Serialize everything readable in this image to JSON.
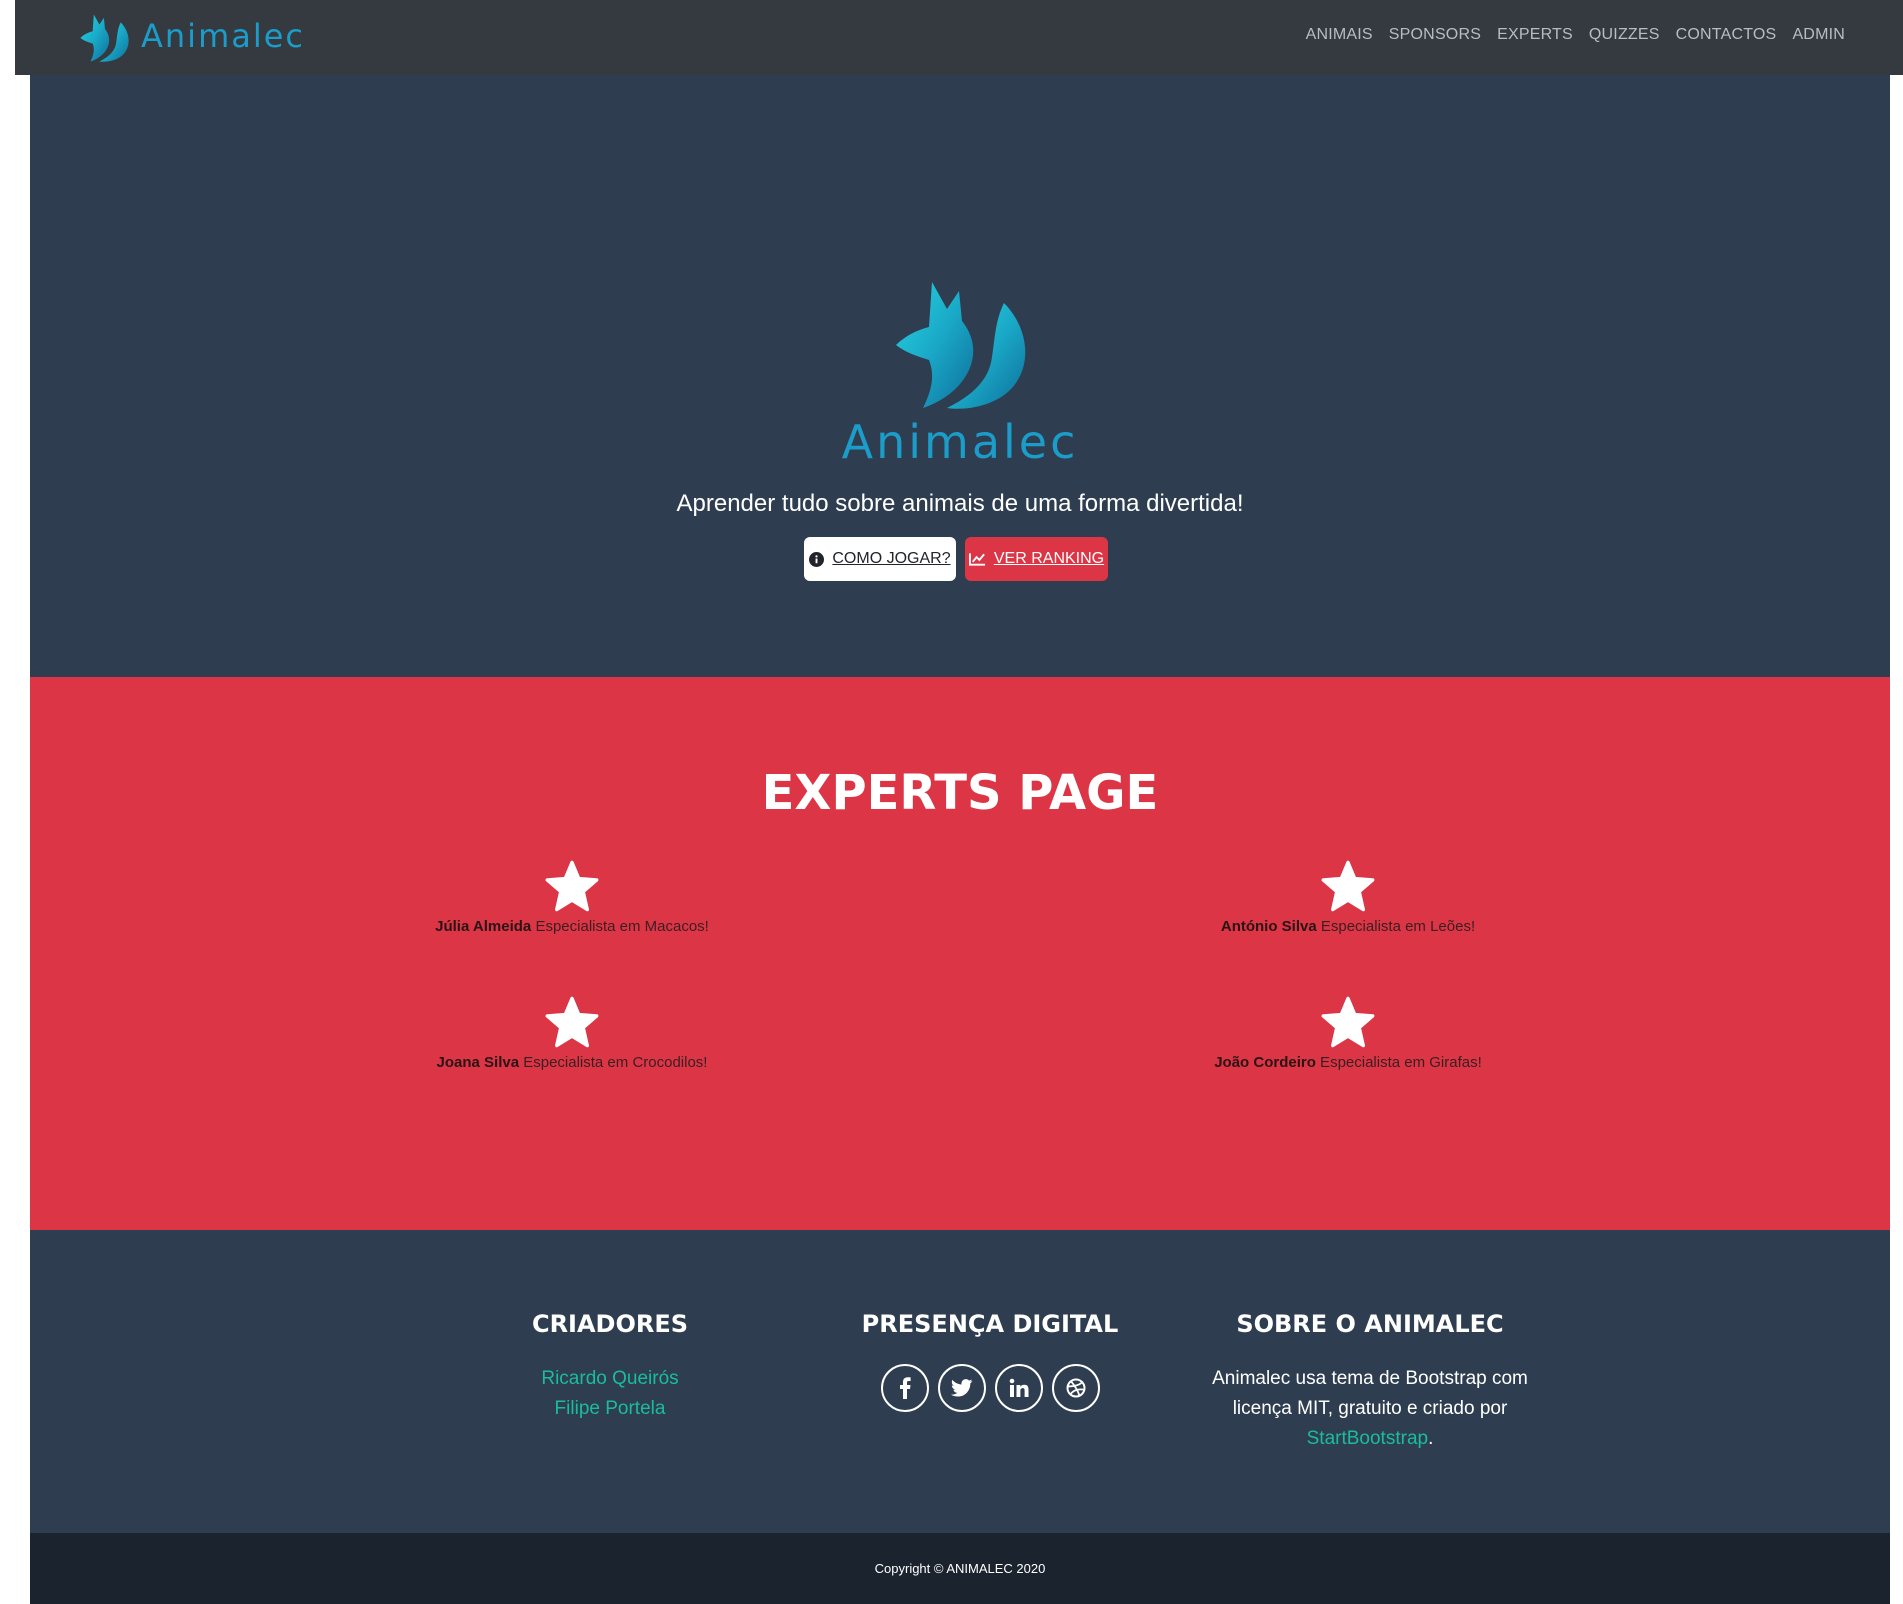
{
  "navbar": {
    "brand": "Animalec",
    "links": [
      "ANIMAIS",
      "SPONSORS",
      "EXPERTS",
      "QUIZZES",
      "CONTACTOS",
      "ADMIN"
    ]
  },
  "masthead": {
    "title": "Animalec",
    "subtitle": "Aprender tudo sobre animais de uma forma divertida!",
    "how_to_play": "COMO JOGAR?",
    "ranking": "VER RANKING"
  },
  "experts": {
    "title": "EXPERTS PAGE",
    "items": [
      {
        "name": "Júlia Almeida",
        "text": " Especialista em Macacos!"
      },
      {
        "name": "António Silva",
        "text": " Especialista em Leões!"
      },
      {
        "name": "Joana Silva",
        "text": " Especialista em Crocodilos!"
      },
      {
        "name": "João Cordeiro",
        "text": " Especialista em Girafas!"
      }
    ]
  },
  "footer": {
    "creators_heading": "CRIADORES",
    "creators": [
      "Ricardo Queirós",
      "Filipe Portela"
    ],
    "digital_heading": "PRESENÇA DIGITAL",
    "social_icons": [
      "facebook-icon",
      "twitter-icon",
      "linkedin-icon",
      "dribbble-icon"
    ],
    "about_heading": "SOBRE O ANIMALEC",
    "about_text": "Animalec usa tema de Bootstrap com licença MIT, gratuito e criado por ",
    "about_link": "StartBootstrap",
    "about_end": "."
  },
  "copyright": "Copyright © ANIMALEC 2020",
  "colors": {
    "navbar": "#343a40",
    "primary_dark": "#2e3e50",
    "danger": "#dc3545",
    "brand": "#1b9cc9",
    "link": "#1abc9c",
    "copyright_bg": "#1b242e"
  }
}
